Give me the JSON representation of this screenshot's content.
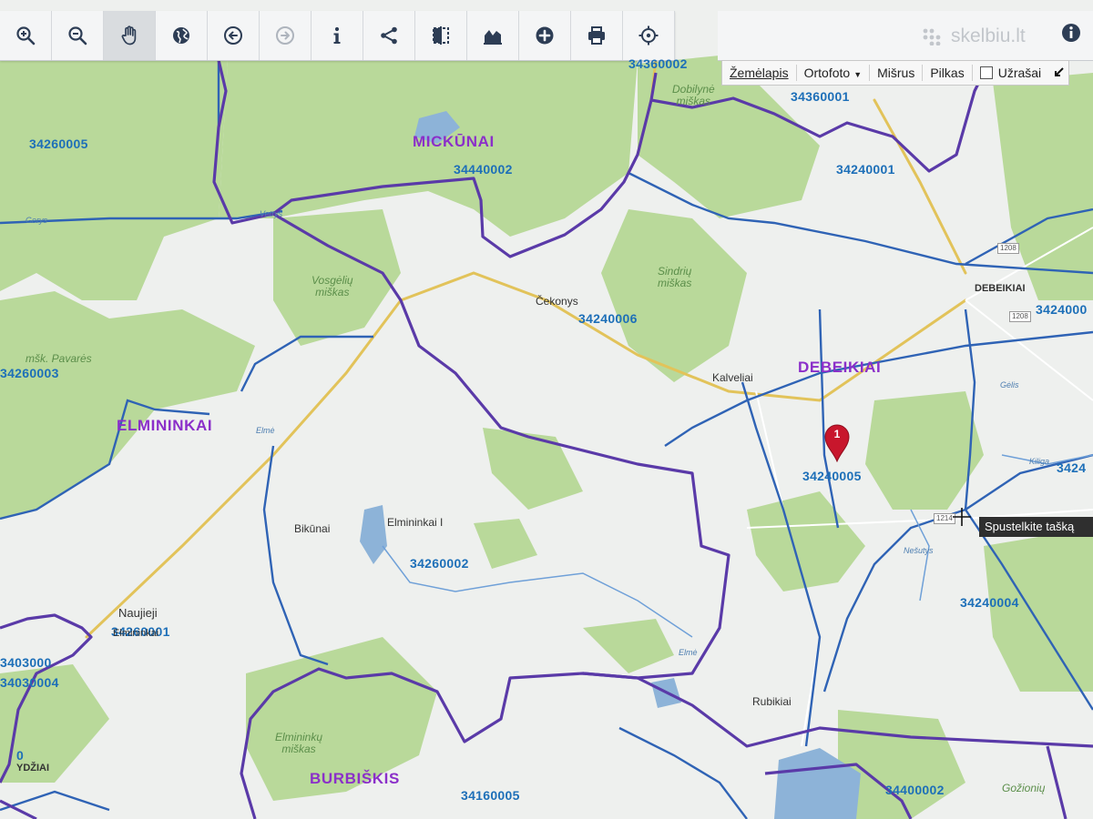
{
  "toolbar": {
    "tools": [
      {
        "name": "zoom-in-icon"
      },
      {
        "name": "zoom-out-icon"
      },
      {
        "name": "pan-hand-icon",
        "active": true
      },
      {
        "name": "globe-icon"
      },
      {
        "name": "back-arrow-icon"
      },
      {
        "name": "forward-arrow-icon",
        "disabled": true
      },
      {
        "name": "info-icon"
      },
      {
        "name": "share-icon"
      },
      {
        "name": "compare-icon"
      },
      {
        "name": "profile-chart-icon"
      },
      {
        "name": "add-circle-icon"
      },
      {
        "name": "print-icon"
      },
      {
        "name": "locate-crosshair-icon"
      }
    ],
    "info_icon": "info-icon"
  },
  "brand": {
    "text": "skelbiu.lt"
  },
  "layers": {
    "zemelapis": "Žemėlapis",
    "ortofoto": "Ortofoto",
    "misrus": "Mišrus",
    "pilkas": "Pilkas",
    "uzrasai": "Užrašai"
  },
  "colors": {
    "boundary_main": "#5a3aa8",
    "boundary_minor": "#2f63b5",
    "parcel_label": "#1d6fb8",
    "region_label": "#8b2fc9",
    "forest": "#b9d99a",
    "open_land": "#eef0ee",
    "water": "#8db3d8",
    "road": "#e2c35a",
    "marker": "#c8162c"
  },
  "map": {
    "parcels": {
      "p1": "34360002",
      "p2": "34360001",
      "p3": "34260005",
      "p4": "34440002",
      "p5": "34240001",
      "p6": "34240006",
      "p7": "3424000",
      "p8": "34260003",
      "p9": "34240005",
      "p10": "3424",
      "p11": "34260002",
      "p12": "34240004",
      "p13": "34260001",
      "p14": "3403000",
      "p15": "34030004",
      "p16": "34160005",
      "p17": "34400002",
      "p18": "0"
    },
    "regions": {
      "r1": "MICKŪNAI",
      "r2": "DEBEIKIAI",
      "r3": "ELMININKAI",
      "r4": "BURBIŠKIS"
    },
    "places": {
      "c1": "Čekonys",
      "c2": "Kalveliai",
      "c3": "DEBEIKIAI",
      "c4": "Bikūnai",
      "c5": "Elmininkai I",
      "c6": "Naujieji",
      "c7": "Elmininkai",
      "c8": "Rubikiai",
      "c9": "YDŽIAI"
    },
    "forests": {
      "f1": "Dobilynė\nmiškas",
      "f2": "Vosgėlių\nmiškas",
      "f3": "Sindrių\nmiškas",
      "f4": "mšk. Pavarės",
      "f5": "Elmininkų\nmiškas",
      "f6": "Gožionių"
    },
    "roads": {
      "w1": "Vetrys",
      "w2": "Gerys",
      "w3": "Elmė",
      "w4": "Elmė",
      "w5": "Kiliga",
      "w6": "Nešutys",
      "w7": "Gėlis",
      "s1": "1208",
      "s2": "1208",
      "s3": "1214"
    },
    "marker": {
      "number": "1"
    },
    "tooltip": "Spustelkite tašką"
  }
}
